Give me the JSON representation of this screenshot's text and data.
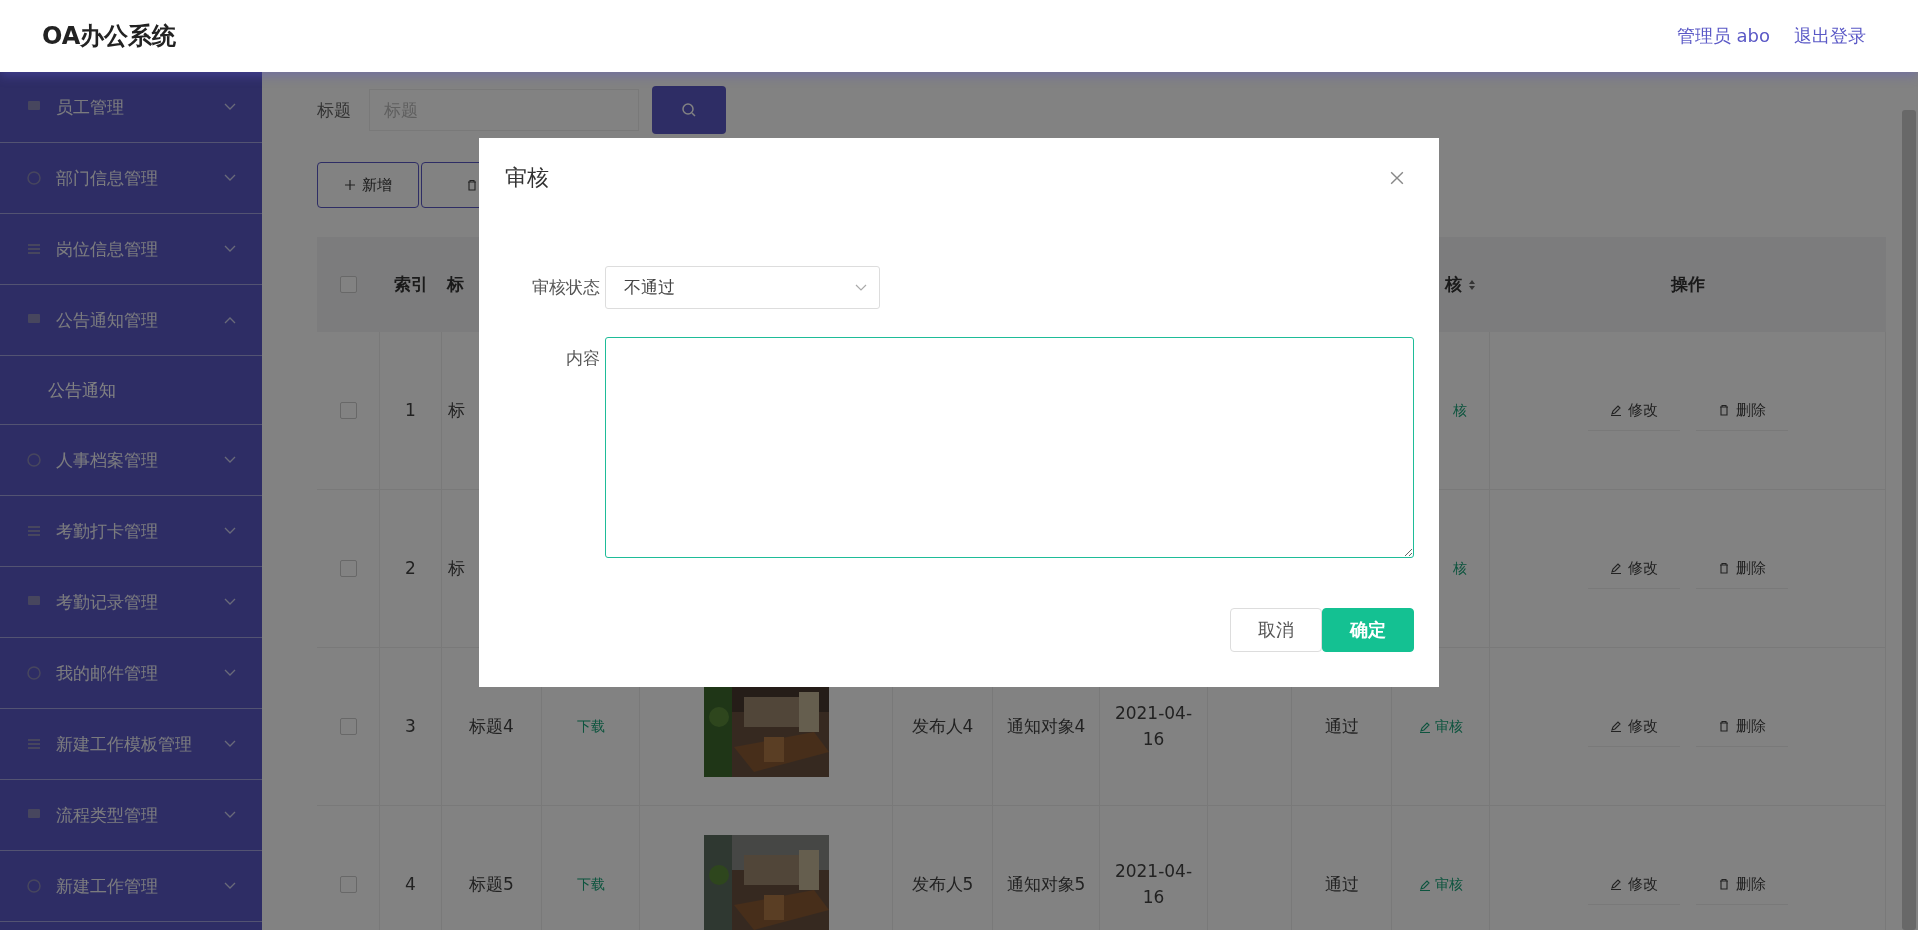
{
  "header": {
    "title": "OA办公系统",
    "user": "管理员 abo",
    "logout": "退出登录"
  },
  "sidebar": {
    "items": [
      {
        "label": "员工管理",
        "expanded": false
      },
      {
        "label": "部门信息管理",
        "expanded": false
      },
      {
        "label": "岗位信息管理",
        "expanded": false
      },
      {
        "label": "公告通知管理",
        "expanded": true,
        "children": [
          {
            "label": "公告通知"
          }
        ]
      },
      {
        "label": "人事档案管理",
        "expanded": false
      },
      {
        "label": "考勤打卡管理",
        "expanded": false
      },
      {
        "label": "考勤记录管理",
        "expanded": false
      },
      {
        "label": "我的邮件管理",
        "expanded": false
      },
      {
        "label": "新建工作模板管理",
        "expanded": false
      },
      {
        "label": "流程类型管理",
        "expanded": false
      },
      {
        "label": "新建工作管理",
        "expanded": false
      }
    ]
  },
  "search": {
    "label": "标题",
    "placeholder": "标题"
  },
  "toolbar": {
    "buttons": [
      {
        "kind": "add",
        "label": "新增"
      },
      {
        "kind": "delete"
      }
    ]
  },
  "table": {
    "columns": [
      {
        "kind": "checkbox",
        "checked": false
      },
      {
        "label": "索引"
      },
      {
        "label": "标",
        "kind": "clipped"
      },
      {},
      {},
      {},
      {},
      {},
      {},
      {},
      {
        "label": "核",
        "sortable": true
      },
      {
        "label": "操作"
      }
    ],
    "rows": [
      {
        "cells": [
          {
            "kind": "checkbox",
            "checked": false
          },
          {
            "kind": "text",
            "text": "1"
          },
          {
            "kind": "clipped",
            "text": "标"
          },
          {},
          {},
          {},
          {},
          {},
          {},
          {},
          {
            "kind": "action",
            "text": "核",
            "icon": false
          },
          {
            "kind": "ops",
            "buttons": [
              "修改",
              "删除"
            ]
          }
        ]
      },
      {
        "cells": [
          {
            "kind": "checkbox",
            "checked": false
          },
          {
            "kind": "text",
            "text": "2"
          },
          {
            "kind": "clipped",
            "text": "标"
          },
          {},
          {},
          {},
          {},
          {},
          {},
          {},
          {
            "kind": "action",
            "text": "核",
            "icon": false
          },
          {
            "kind": "ops",
            "buttons": [
              "修改",
              "删除"
            ]
          }
        ]
      },
      {
        "cells": [
          {
            "kind": "checkbox",
            "checked": false
          },
          {
            "kind": "text",
            "text": "3"
          },
          {
            "kind": "text",
            "text": "标题4"
          },
          {
            "kind": "link",
            "text": "下载"
          },
          {
            "kind": "picture"
          },
          {
            "kind": "text",
            "text": "发布人4"
          },
          {
            "kind": "text",
            "text": "通知对象4"
          },
          {
            "kind": "text",
            "text": "2021-04-16"
          },
          {},
          {
            "kind": "text",
            "text": "通过"
          },
          {
            "kind": "action",
            "text": "审核",
            "icon": true
          },
          {
            "kind": "ops",
            "buttons": [
              "修改",
              "删除"
            ]
          }
        ]
      },
      {
        "cells": [
          {
            "kind": "checkbox",
            "checked": false
          },
          {
            "kind": "text",
            "text": "4"
          },
          {
            "kind": "text",
            "text": "标题5"
          },
          {
            "kind": "link",
            "text": "下载"
          },
          {
            "kind": "picture"
          },
          {
            "kind": "text",
            "text": "发布人5"
          },
          {
            "kind": "text",
            "text": "通知对象5"
          },
          {
            "kind": "text",
            "text": "2021-04-16"
          },
          {},
          {
            "kind": "text",
            "text": "通过"
          },
          {
            "kind": "action",
            "text": "审核",
            "icon": true
          },
          {
            "kind": "ops",
            "buttons": [
              "修改",
              "删除"
            ]
          }
        ]
      }
    ]
  },
  "modal": {
    "title": "审核",
    "fields": [
      {
        "kind": "select",
        "label": "审核状态",
        "value": "不通过"
      },
      {
        "kind": "textarea",
        "label": "内容",
        "focused": true
      }
    ],
    "buttons": [
      {
        "kind": "default",
        "label": "取消"
      },
      {
        "kind": "primary",
        "label": "确定"
      }
    ]
  }
}
